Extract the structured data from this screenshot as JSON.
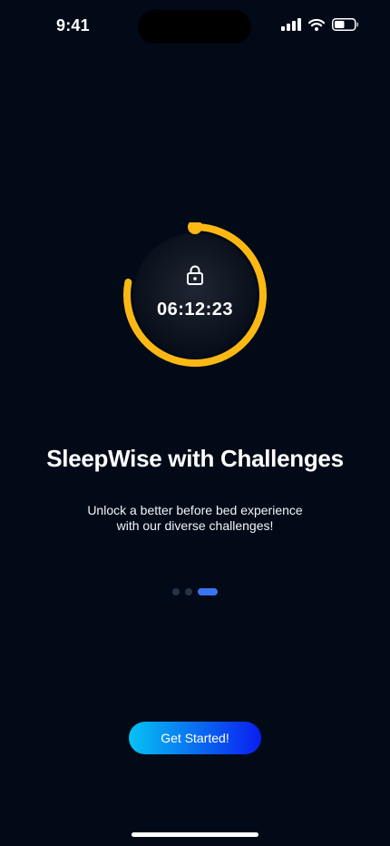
{
  "status_bar": {
    "time": "9:41",
    "icons": [
      "cellular-signal-icon",
      "wifi-icon",
      "battery-icon"
    ],
    "battery_level": 0.5
  },
  "timer": {
    "value": "06:12:23",
    "progress": 0.78,
    "ring_color": "#FDB813",
    "icon": "lock-icon"
  },
  "onboarding": {
    "title": "SleepWise with Challenges",
    "subtitle_line1": "Unlock a better before bed experience",
    "subtitle_line2": "with our diverse challenges!",
    "page_count": 3,
    "active_page": 3
  },
  "cta": {
    "label": "Get Started!"
  },
  "colors": {
    "background": "#020A18",
    "accent": "#3A74F2",
    "inactive_dot": "#243349",
    "button_gradient_start": "#06C2F5",
    "button_gradient_end": "#0A1EF0"
  }
}
